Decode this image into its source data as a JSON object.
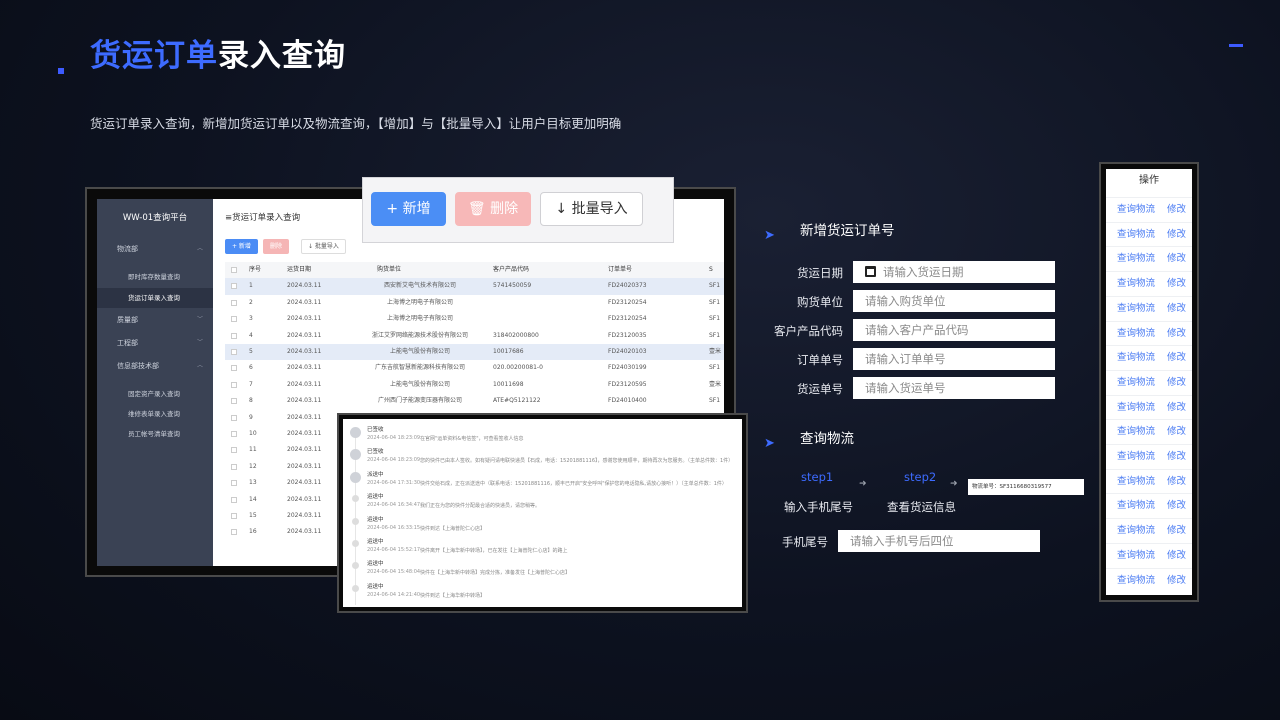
{
  "header": {
    "title_highlight": "货运订单",
    "title_rest": "录入查询",
    "subtitle": "货运订单录入查询，新增加货运订单以及物流查询，【增加】与【批量导入】让用户目标更加明确"
  },
  "app": {
    "platform_title": "WW-01查询平台",
    "content_title": "≡货运订单录入查询",
    "sidebar": {
      "logistics": "物流部",
      "realtime_stock": "即时库存数量查询",
      "freight_entry": "货运订单录入查询",
      "quality": "质量部",
      "engineering": "工程部",
      "it": "信息部技术部",
      "fixed_assets": "固定资产录入查询",
      "repair_orders": "维修表单录入查询",
      "staff_accounts": "员工帐号清单查询"
    },
    "mini_buttons": {
      "add": "+ 新增",
      "delete": "删除",
      "import": "↓ 批量导入"
    },
    "table": {
      "columns": [
        "序号",
        "运货日期",
        "购货单位",
        "客户产品代码",
        "订单单号",
        "S"
      ],
      "rows": [
        [
          "1",
          "2024.03.11",
          "西安新艾电气技术有限公司",
          "5741450059",
          "FD24020373",
          "SF1"
        ],
        [
          "2",
          "2024.03.11",
          "上海博之明电子有限公司",
          "",
          "FD23120254",
          "SF1"
        ],
        [
          "3",
          "2024.03.11",
          "上海博之明电子有限公司",
          "",
          "FD23120254",
          "SF1"
        ],
        [
          "4",
          "2024.03.11",
          "浙江艾罗网络能源技术股份有限公司",
          "318402000800",
          "FD23120035",
          "SF1"
        ],
        [
          "5",
          "2024.03.11",
          "上能电气股份有限公司",
          "10017686",
          "FD24020103",
          "壹米"
        ],
        [
          "6",
          "2024.03.11",
          "广东吉航智慧新能源科技有限公司",
          "020.00200081-0",
          "FD24030199",
          "SF1"
        ],
        [
          "7",
          "2024.03.11",
          "上能电气股份有限公司",
          "10011698",
          "FD23120595",
          "壹米"
        ],
        [
          "8",
          "2024.03.11",
          "广州西门子能源变压器有限公司",
          "ATE#Q5121122",
          "FD24010400",
          "SF1"
        ],
        [
          "9",
          "2024.03.11",
          "",
          "",
          "",
          ""
        ],
        [
          "10",
          "2024.03.11",
          "",
          "",
          "",
          ""
        ],
        [
          "11",
          "2024.03.11",
          "",
          "",
          "",
          ""
        ],
        [
          "12",
          "2024.03.11",
          "",
          "",
          "",
          ""
        ],
        [
          "13",
          "2024.03.11",
          "",
          "",
          "",
          ""
        ],
        [
          "14",
          "2024.03.11",
          "",
          "",
          "",
          ""
        ],
        [
          "15",
          "2024.03.11",
          "",
          "",
          "",
          ""
        ],
        [
          "16",
          "2024.03.11",
          "",
          "",
          "",
          ""
        ]
      ]
    }
  },
  "toolbar": {
    "add": "+ 新增",
    "delete": "删除",
    "import": "批量导入"
  },
  "logistics_timeline": [
    {
      "status": "已签收",
      "time": "2024-06-04 18:23:09",
      "desc": "在官网\"运单资料&电信签\"，可查看签收人信息"
    },
    {
      "status": "已签收",
      "time": "2024-06-04 18:23:09",
      "desc": "您的快件已由本人签收。如有疑问请电联快递员【石成，电话：15201881116】，感谢您使用顺丰，期待再次为您服务。（主单总件数：1件）"
    },
    {
      "status": "派送中",
      "time": "2024-06-04 17:31:30",
      "desc": "快件交给石成，正在派送途中（联系电话：15201881116，顺丰已开启\"安全呼叫\"保护您的电话隐私,请放心接听！）（主单总件数：1件）"
    },
    {
      "status": "运送中",
      "time": "2024-06-04 16:34:47",
      "desc": "我们正在为您的快件分配最合适的快递员，请您稍等。"
    },
    {
      "status": "运送中",
      "time": "2024-06-04 16:33:15",
      "desc": "快件到达【上海普陀仁心店】"
    },
    {
      "status": "运送中",
      "time": "2024-06-04 15:52:17",
      "desc": "快件离开【上海华新中转场】，已在发往【上海普陀仁心店】的路上"
    },
    {
      "status": "运送中",
      "time": "2024-06-04 15:48:04",
      "desc": "快件在【上海华新中转场】完成分拣，准备发往【上海普陀仁心店】"
    },
    {
      "status": "运送中",
      "time": "2024-06-04 14:21:40",
      "desc": "快件到达【上海华新中转场】"
    }
  ],
  "new_order": {
    "title": "新增货运订单号",
    "fields": [
      {
        "label": "货运日期",
        "placeholder": "请输入货运日期",
        "icon": "calendar-icon"
      },
      {
        "label": "购货单位",
        "placeholder": "请输入购货单位"
      },
      {
        "label": "客户产品代码",
        "placeholder": "请输入客户产品代码"
      },
      {
        "label": "订单单号",
        "placeholder": "请输入订单单号"
      },
      {
        "label": "货运单号",
        "placeholder": "请输入货运单号"
      }
    ]
  },
  "logistics_query": {
    "title": "查询物流",
    "step1": "step1",
    "step2": "step2",
    "step1_desc": "输入手机尾号",
    "step2_desc": "查看货运信息",
    "tracking_result": "物流单号：SF3116680319577",
    "phone_label": "手机尾号",
    "phone_placeholder": "请输入手机号后四位"
  },
  "operations": {
    "header": "操作",
    "query_label": "查询物流",
    "edit_label": "修改",
    "row_count": 16
  },
  "colors": {
    "accent": "#3d6bff",
    "link": "#4b7cf3",
    "add_button": "#4b8ef5",
    "delete_button": "#f7b8b8"
  }
}
